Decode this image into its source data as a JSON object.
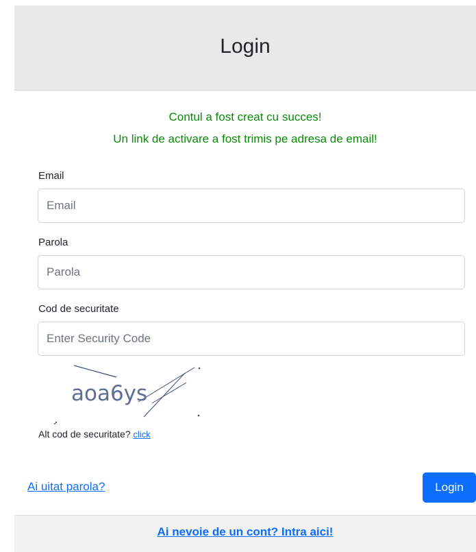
{
  "header": {
    "title": "Login"
  },
  "messages": {
    "success": "Contul a fost creat cu succes!",
    "activation": "Un link de activare a fost trimis pe adresa de email!"
  },
  "form": {
    "email": {
      "label": "Email",
      "placeholder": "Email",
      "value": ""
    },
    "password": {
      "label": "Parola",
      "placeholder": "Parola",
      "value": ""
    },
    "security_code": {
      "label": "Cod de securitate",
      "placeholder": "Enter Security Code",
      "value": ""
    },
    "captcha_text": "aoa6ys",
    "alt_code_text": "Alt cod de securitate?",
    "alt_code_link": "click"
  },
  "actions": {
    "forgot_password": "Ai uitat parola?",
    "login_button": "Login"
  },
  "footer": {
    "register_link": "Ai nevoie de un cont? Intra aici!"
  },
  "colors": {
    "primary": "#0d6efd",
    "success_text": "#0a8a0a",
    "header_bg": "#e9e9e9"
  }
}
